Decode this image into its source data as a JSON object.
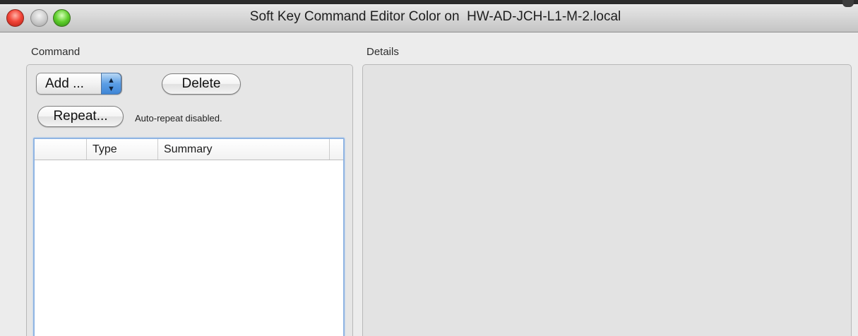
{
  "window": {
    "title": "Soft Key Command Editor Color on  HW-AD-JCH-L1-M-2.local"
  },
  "command_group": {
    "label": "Command",
    "add_popup_label": "Add ...",
    "add_popup_arrows": "▲\n▼",
    "delete_label": "Delete",
    "repeat_label": "Repeat...",
    "repeat_status": "Auto-repeat disabled.",
    "table": {
      "columns": [
        "",
        "Type",
        "Summary",
        ""
      ],
      "rows": []
    }
  },
  "details_group": {
    "label": "Details"
  },
  "colors": {
    "close": "#f3473a",
    "minimize": "#c9c9c9",
    "zoom": "#60cf2d",
    "table_focus": "#8fb4e3",
    "popup_accent": "#5b9ee5"
  }
}
